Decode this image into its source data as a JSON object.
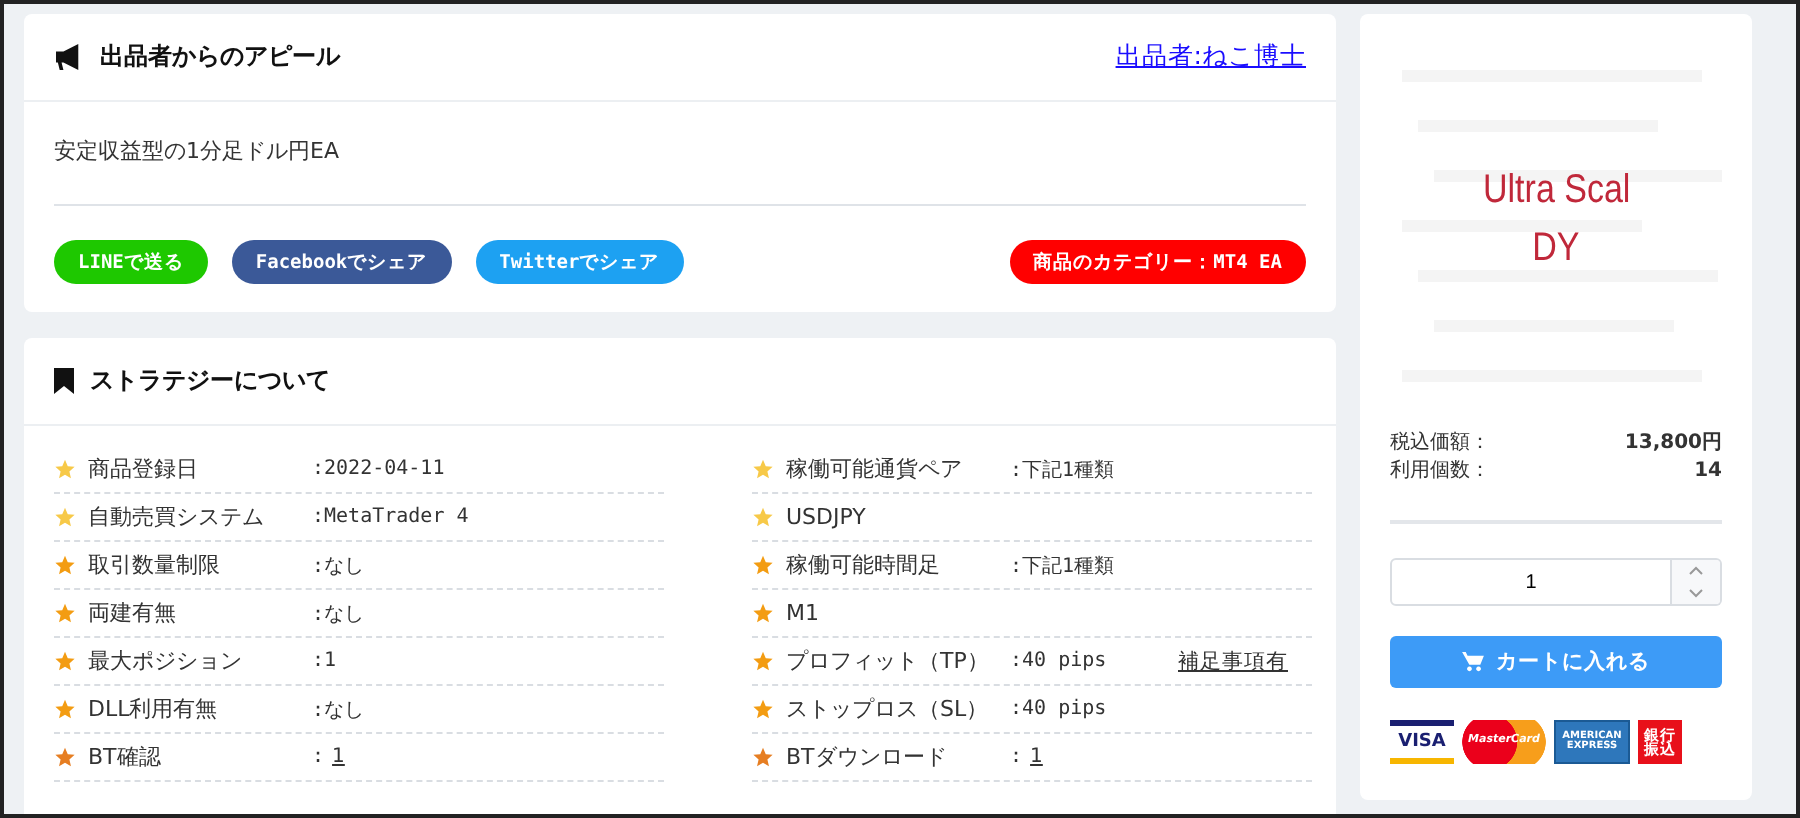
{
  "appeal": {
    "title": "出品者からのアピール",
    "seller_link": "出品者:ねこ博士",
    "description": "安定収益型の1分足ドル円EA",
    "share_buttons": [
      {
        "kind": "line",
        "label": "LINEで送る"
      },
      {
        "kind": "facebook",
        "label": "Facebookでシェア"
      },
      {
        "kind": "twitter",
        "label": "Twitterでシェア"
      }
    ],
    "category": "商品のカテゴリー：MT4 EA"
  },
  "strategy": {
    "title": "ストラテジーについて",
    "left": [
      {
        "label": "商品登録日",
        "value": ":2022-04-11",
        "color": "#f7c948"
      },
      {
        "label": "自動売買システム",
        "value": ":MetaTrader 4",
        "color": "#f7c948"
      },
      {
        "label": "取引数量制限",
        "value": ":なし",
        "color": "#f39c12"
      },
      {
        "label": "両建有無",
        "value": ":なし",
        "color": "#f39c12"
      },
      {
        "label": "最大ポジション",
        "value": ":1",
        "color": "#f39c12"
      },
      {
        "label": "DLL利用有無",
        "value": ":なし",
        "color": "#f39c12"
      },
      {
        "label": "BT確認",
        "value": ":",
        "link": "1",
        "color": "#e67e22"
      }
    ],
    "right": [
      {
        "label": "稼働可能通貨ペア",
        "value": ":下記1種類",
        "color": "#f7c948"
      },
      {
        "label": "USDJPY",
        "color": "#f7c948"
      },
      {
        "label": "稼働可能時間足",
        "value": ":下記1種類",
        "color": "#f39c12"
      },
      {
        "label": "M1",
        "color": "#f39c12"
      },
      {
        "label": "プロフィット（TP）",
        "value": ":40 pips",
        "link": "補足事項有",
        "color": "#f39c12"
      },
      {
        "label": "ストップロス（SL）",
        "value": ":40 pips",
        "color": "#f39c12"
      },
      {
        "label": "BTダウンロード",
        "value": ":",
        "link": "1",
        "color": "#e67e22"
      }
    ]
  },
  "product": {
    "image_title": [
      "Ultra Scal",
      "DY"
    ],
    "price_label": "税込価額：",
    "price": "13,800円",
    "usage_label": "利用個数：",
    "usage": "14",
    "quantity": "1",
    "cart_button": "カートに入れる",
    "payments": [
      {
        "kind": "visa",
        "label": "VISA"
      },
      {
        "kind": "mastercard",
        "label": "MasterCard"
      },
      {
        "kind": "amex",
        "label": "AMERICAN EXPRESS"
      },
      {
        "kind": "bank",
        "label": "銀行振込"
      }
    ]
  }
}
